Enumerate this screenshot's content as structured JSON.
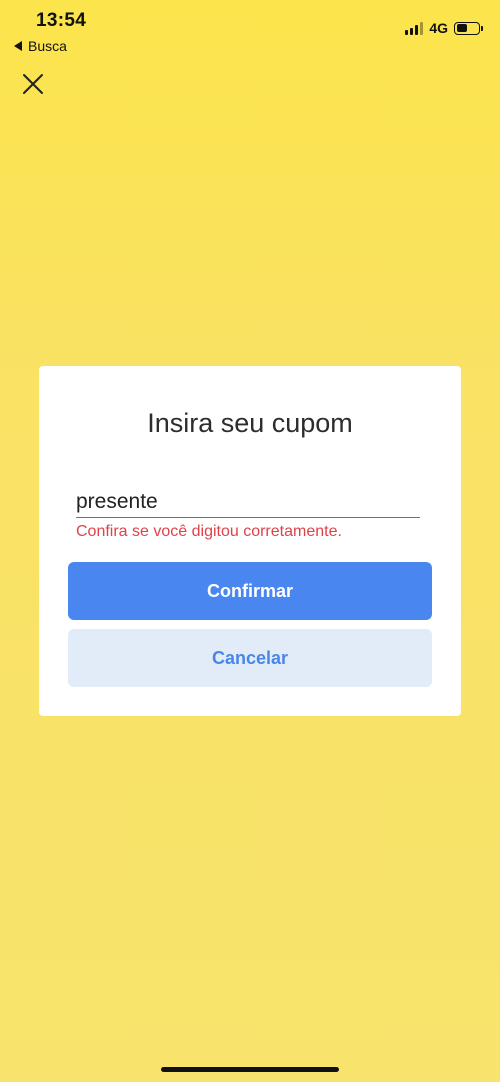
{
  "status_bar": {
    "time": "13:54",
    "back_label": "Busca",
    "network": "4G",
    "battery_level": 0.5
  },
  "icons": {
    "close": "close-icon",
    "back": "back-arrow-icon",
    "signal": "signal-icon",
    "battery": "battery-icon"
  },
  "dialog": {
    "title": "Insira seu cupom",
    "coupon_value": "presente",
    "error_message": "Confira se você digitou corretamente.",
    "confirm_label": "Confirmar",
    "cancel_label": "Cancelar"
  },
  "colors": {
    "background": "#fae260",
    "primary": "#4a86f0",
    "secondary_bg": "#e2ecf8",
    "error": "#e0424a"
  }
}
